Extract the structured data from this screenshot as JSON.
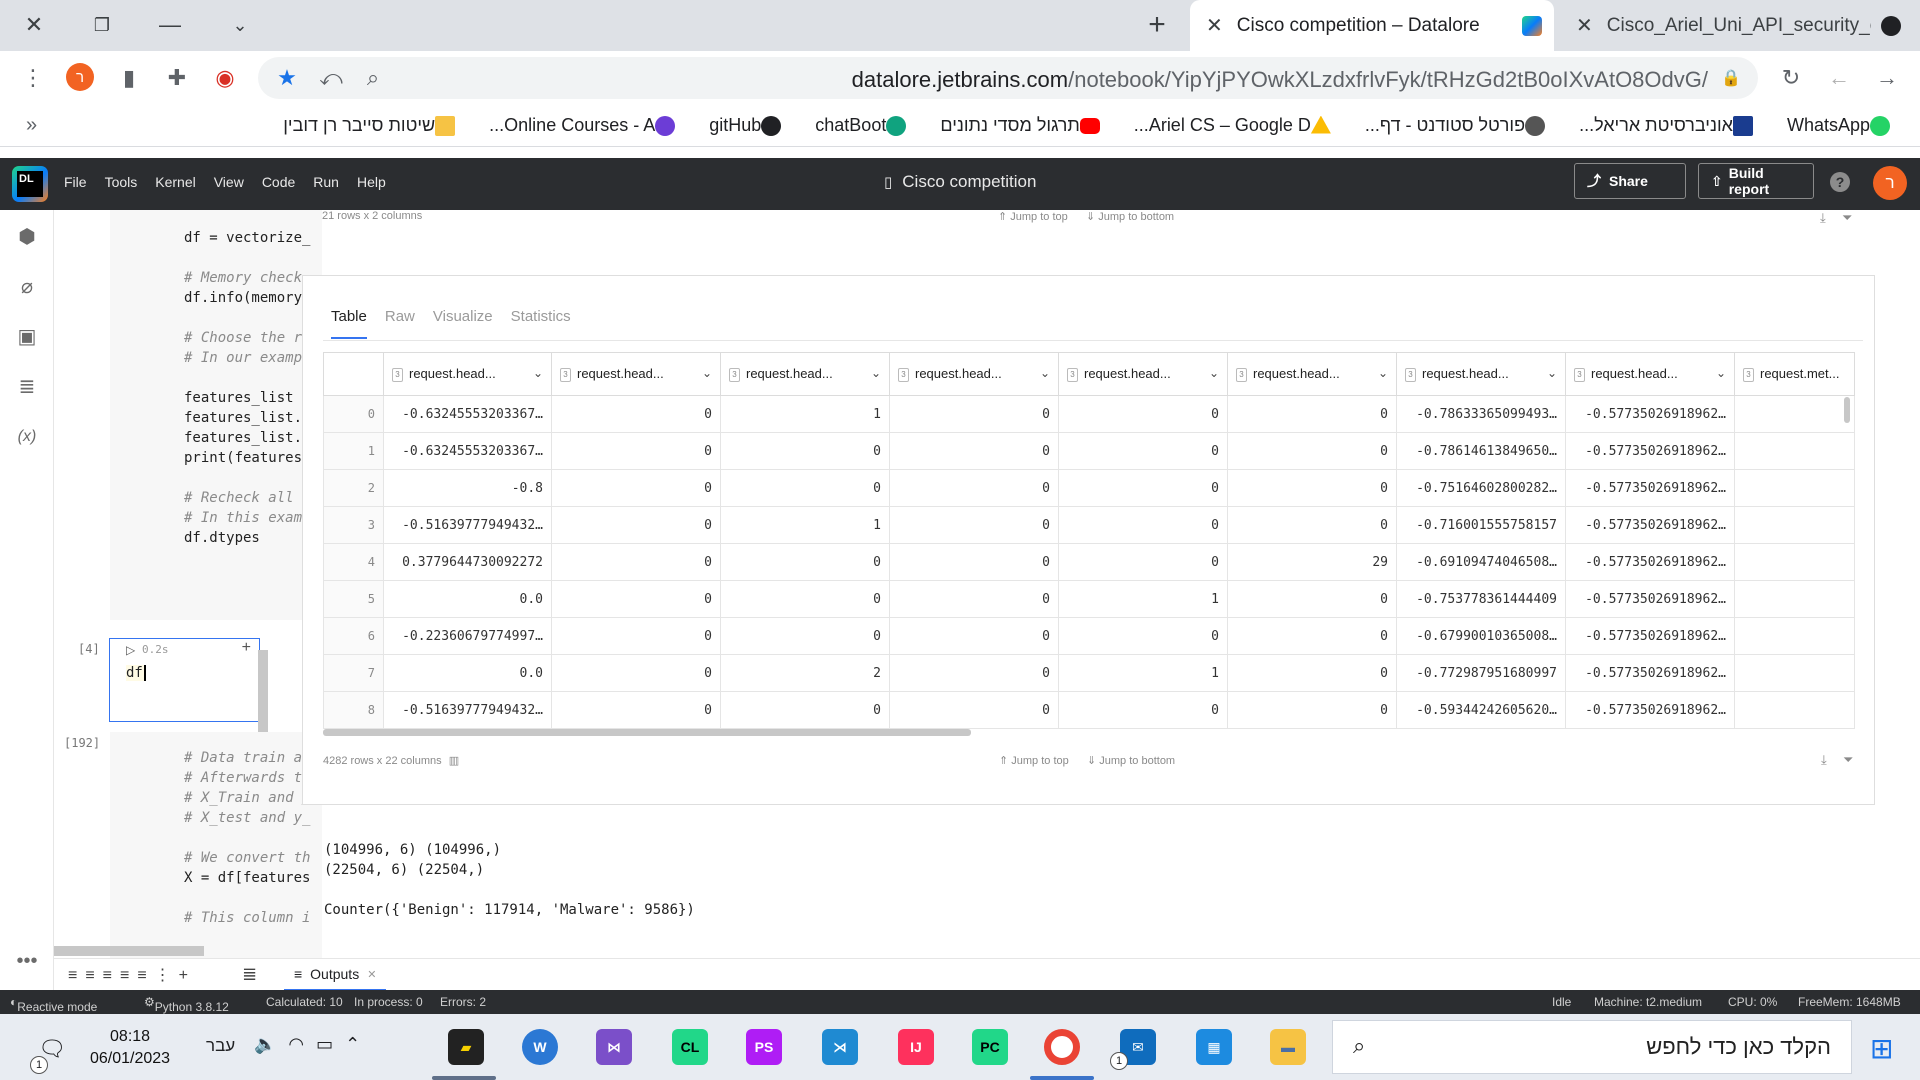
{
  "browser": {
    "tabs": [
      {
        "title": "Cisco competition – Datalore",
        "active": true
      },
      {
        "title": "Cisco_Ariel_Uni_API_security_chal",
        "active": false
      }
    ],
    "url_domain": "datalore.jetbrains.com",
    "url_path": "/notebook/YipYjPYOwkXLzdxfrlvFyk/tRHzGd2tB0oIXvAtO8OdvG/",
    "profile_initial": "ר"
  },
  "bookmarks": [
    {
      "label": "WhatsApp",
      "icon": "whatsapp-icon",
      "color": "#25d366"
    },
    {
      "label": "אוניברסיטת אריאל...",
      "icon": "ariel-icon",
      "color": "#1a3c8f"
    },
    {
      "label": "פורטל סטודנט - דף...",
      "icon": "portal-icon",
      "color": "#444444"
    },
    {
      "label": "Ariel CS – Google D...",
      "icon": "drive-icon",
      "color": "#fbbc04"
    },
    {
      "label": "תרגול מסדי נתונים",
      "icon": "youtube-icon",
      "color": "#ff0000"
    },
    {
      "label": "chatBoot",
      "icon": "openai-icon",
      "color": "#10a37f"
    },
    {
      "label": "gitHub",
      "icon": "github-icon",
      "color": "#202124"
    },
    {
      "label": "Online Courses - A...",
      "icon": "course-icon",
      "color": "#6c3dd6"
    },
    {
      "label": "שיטות סייבר רן דובין",
      "icon": "folder-icon",
      "color": "#f6c344"
    }
  ],
  "datalore": {
    "menu": [
      "File",
      "Tools",
      "Kernel",
      "View",
      "Code",
      "Run",
      "Help"
    ],
    "notebook_title": "Cisco competition",
    "share_label": "Share",
    "build_report_label": "Build report",
    "user_initial": "ר"
  },
  "cells": {
    "cell1_code": [
      "df = vectorize_",
      "",
      "# Memory check",
      "df.info(memory_",
      "",
      "# Choose the ri",
      "# In our exampl",
      "",
      "features_list =",
      "features_list.r",
      "features_list.r",
      "print(features_",
      "",
      "# Recheck all a",
      "# In this examp",
      "df.dtypes"
    ],
    "cell2_exec": "[4]",
    "cell2_time": "0.2s",
    "cell2_code": "df",
    "cell3_exec": "[192]",
    "cell3_code": [
      "# Data train an",
      "# Afterwards th",
      "# X_Train and y",
      "# X_test and y_",
      "",
      "# We convert th",
      "X = df[features",
      "",
      "# This column i"
    ]
  },
  "output": {
    "top_meta": "21 rows x 2 columns",
    "jump_top": "Jump to top",
    "jump_bottom": "Jump to bottom",
    "tabs": [
      "Table",
      "Raw",
      "Visualize",
      "Statistics"
    ],
    "columns": [
      "request.head...",
      "request.head...",
      "request.head...",
      "request.head...",
      "request.head...",
      "request.head...",
      "request.head...",
      "request.head...",
      "request.met..."
    ],
    "rows": [
      {
        "idx": "0",
        "v": [
          "-0.63245553203367…",
          "0",
          "1",
          "0",
          "0",
          "0",
          "-0.78633365099493…",
          "-0.57735026918962…",
          ""
        ]
      },
      {
        "idx": "1",
        "v": [
          "-0.63245553203367…",
          "0",
          "0",
          "0",
          "0",
          "0",
          "-0.78614613849650…",
          "-0.57735026918962…",
          ""
        ]
      },
      {
        "idx": "2",
        "v": [
          "-0.8",
          "0",
          "0",
          "0",
          "0",
          "0",
          "-0.75164602800282…",
          "-0.57735026918962…",
          ""
        ]
      },
      {
        "idx": "3",
        "v": [
          "-0.51639777949432…",
          "0",
          "1",
          "0",
          "0",
          "0",
          "-0.716001555758157",
          "-0.57735026918962…",
          ""
        ]
      },
      {
        "idx": "4",
        "v": [
          "0.3779644730092272",
          "0",
          "0",
          "0",
          "0",
          "29",
          "-0.69109474046508…",
          "-0.57735026918962…",
          ""
        ]
      },
      {
        "idx": "5",
        "v": [
          "0.0",
          "0",
          "0",
          "0",
          "1",
          "0",
          "-0.753778361444409",
          "-0.57735026918962…",
          ""
        ]
      },
      {
        "idx": "6",
        "v": [
          "-0.22360679774997…",
          "0",
          "0",
          "0",
          "0",
          "0",
          "-0.67990010365008…",
          "-0.57735026918962…",
          ""
        ]
      },
      {
        "idx": "7",
        "v": [
          "0.0",
          "0",
          "2",
          "0",
          "1",
          "0",
          "-0.772987951680997",
          "-0.57735026918962…",
          ""
        ]
      },
      {
        "idx": "8",
        "v": [
          "-0.51639777949432…",
          "0",
          "0",
          "0",
          "0",
          "0",
          "-0.59344242605620…",
          "-0.57735026918962…",
          ""
        ]
      }
    ],
    "bottom_meta": "4282 rows x 22 columns",
    "print_lines": "(104996, 6) (104996,)\n(22504, 6) (22504,)\n\nCounter({'Benign': 117914, 'Malware': 9586})"
  },
  "bottom_panel": {
    "outputs_label": "Outputs"
  },
  "status": {
    "reactive": "Reactive mode",
    "python": "Python 3.8.12",
    "calculated": "Calculated: 10",
    "in_process": "In process: 0",
    "errors": "Errors: 2",
    "state": "Idle",
    "machine": "Machine: t2.medium",
    "cpu": "CPU: 0%",
    "freemem": "FreeMem: 1648MB"
  },
  "taskbar": {
    "time": "08:18",
    "date": "06/01/2023",
    "lang": "עבר",
    "search_placeholder": "הקלד כאן כדי לחפש",
    "notif_count": "1",
    "mail_count": "1"
  }
}
